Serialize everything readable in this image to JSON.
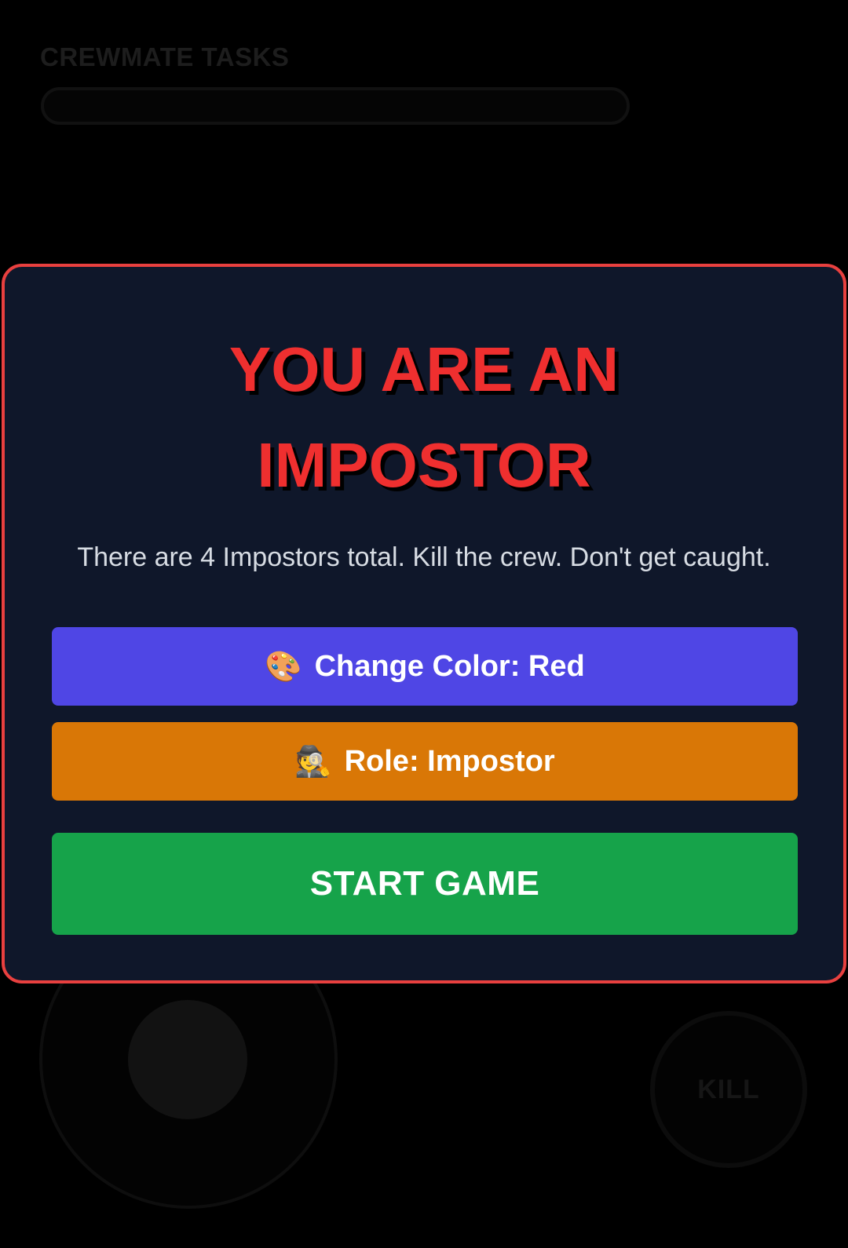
{
  "hud": {
    "tasks_label": "CREWMATE TASKS",
    "tasks_progress": 0,
    "kill_label": "KILL"
  },
  "modal": {
    "title_line1": "YOU ARE AN",
    "title_line2": "IMPOSTOR",
    "subtitle": "There are 4 Impostors total. Kill the crew. Don't get caught.",
    "color_button": {
      "icon": "🎨",
      "icon_name": "palette-icon",
      "label": "Change Color: Red"
    },
    "role_button": {
      "icon": "🕵️",
      "icon_name": "detective-icon",
      "label": "Role: Impostor"
    },
    "start_button": {
      "label": "START GAME"
    }
  },
  "colors": {
    "modal_border": "#e8403f",
    "modal_bg": "#0f172a",
    "title": "#ef2f2f",
    "color_button": "#4f46e5",
    "role_button": "#d97706",
    "start_button": "#16a34a"
  }
}
